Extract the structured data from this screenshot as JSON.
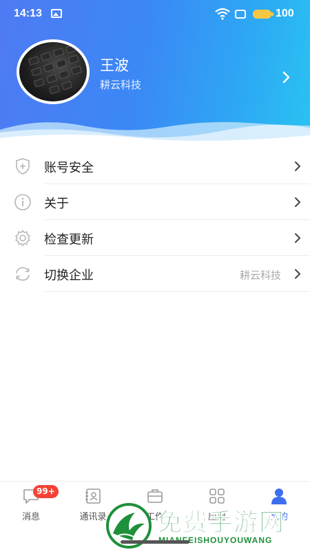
{
  "status_bar": {
    "time": "14:13",
    "battery": "100"
  },
  "profile": {
    "name": "王波",
    "company": "耕云科技"
  },
  "menu": {
    "items": [
      {
        "label": "账号安全",
        "value": ""
      },
      {
        "label": "关于",
        "value": ""
      },
      {
        "label": "检查更新",
        "value": ""
      },
      {
        "label": "切换企业",
        "value": "耕云科技"
      }
    ]
  },
  "bottom_nav": {
    "items": [
      {
        "label": "消息",
        "icon": "message-icon",
        "badge": "99+"
      },
      {
        "label": "通讯录",
        "icon": "contacts-icon"
      },
      {
        "label": "工作",
        "icon": "briefcase-icon"
      },
      {
        "label": "应用",
        "icon": "apps-grid-icon"
      },
      {
        "label": "我的",
        "icon": "person-icon"
      }
    ]
  },
  "watermark": {
    "title": "免费手游网",
    "subtitle": "MIANFEISHOUYOUWANG"
  },
  "colors": {
    "accent": "#3d6ef0",
    "badge": "#f44336",
    "watermark": "#1e8f3a"
  }
}
